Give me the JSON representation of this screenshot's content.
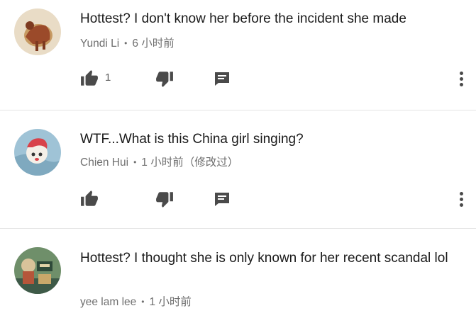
{
  "comments": [
    {
      "text": "Hottest? I don't know her before the incident she made",
      "author": "Yundi Li",
      "separator": "•",
      "time": "6 小时前",
      "likes": "1",
      "avatar_colors": {
        "bg": "#e9dcc6",
        "fg": "#9b4a2a",
        "accent": "#c79a62"
      }
    },
    {
      "text": "WTF...What is this China girl singing?",
      "author": "Chien Hui",
      "separator": "•",
      "time": "1 小时前（修改过）",
      "likes": "",
      "avatar_colors": {
        "bg": "#9fc3d6",
        "fg": "#d8424a",
        "accent": "#f4efe7"
      }
    },
    {
      "text": "Hottest? I thought she is only known for her recent scandal lol",
      "author": "yee lam lee",
      "separator": "•",
      "time": "1 小时前",
      "likes": "",
      "avatar_colors": {
        "bg": "#6f8f6a",
        "fg": "#d9c39a",
        "accent": "#3e5a48"
      }
    }
  ],
  "icons": {
    "like": "thumb-up-icon",
    "dislike": "thumb-down-icon",
    "reply": "reply-comment-icon",
    "more": "more-vertical-icon"
  },
  "colors": {
    "icon": "#4a4a4a",
    "text": "#1a1a1a",
    "meta": "#6f6f6f",
    "divider": "#e3e3e3"
  }
}
